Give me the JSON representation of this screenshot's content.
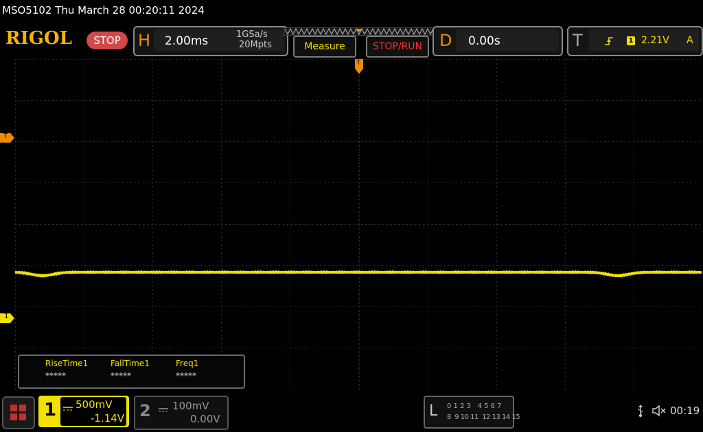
{
  "header": {
    "title": "MSO5102  Thu March 28 00:20:11 2024",
    "logo": "RIGOL",
    "run_state": "STOP"
  },
  "horizontal": {
    "letter": "H",
    "timebase": "2.00ms",
    "sample_rate": "1GSa/s",
    "memory_depth": "20Mpts"
  },
  "buttons": {
    "measure": "Measure",
    "stop_run": "STOP/RUN"
  },
  "delay": {
    "letter": "D",
    "value": "0.00s"
  },
  "trigger": {
    "letter": "T",
    "source": "1",
    "level": "2.21V",
    "sweep": "A"
  },
  "markers": {
    "trigger_pos": "T",
    "trigger_level": "T",
    "channel1": "1"
  },
  "measurements": [
    {
      "label": "RiseTime1",
      "value": "*****"
    },
    {
      "label": "FallTime1",
      "value": "*****"
    },
    {
      "label": "Freq1",
      "value": "*****"
    }
  ],
  "channel1": {
    "number": "1",
    "scale": "500mV",
    "offset": "-1.14V"
  },
  "channel2": {
    "number": "2",
    "scale": "100mV",
    "offset": "0.00V"
  },
  "logic": {
    "letter": "L",
    "row1": "0 1 2 3   4 5 6 7",
    "row2": "8  9 10 11  12 13 14 15"
  },
  "status": {
    "time": "00:19"
  },
  "colors": {
    "ch1": "#f2e100",
    "accent_orange": "#f08a00",
    "stop_red": "#d04848",
    "grid": "#2e2e2e"
  }
}
